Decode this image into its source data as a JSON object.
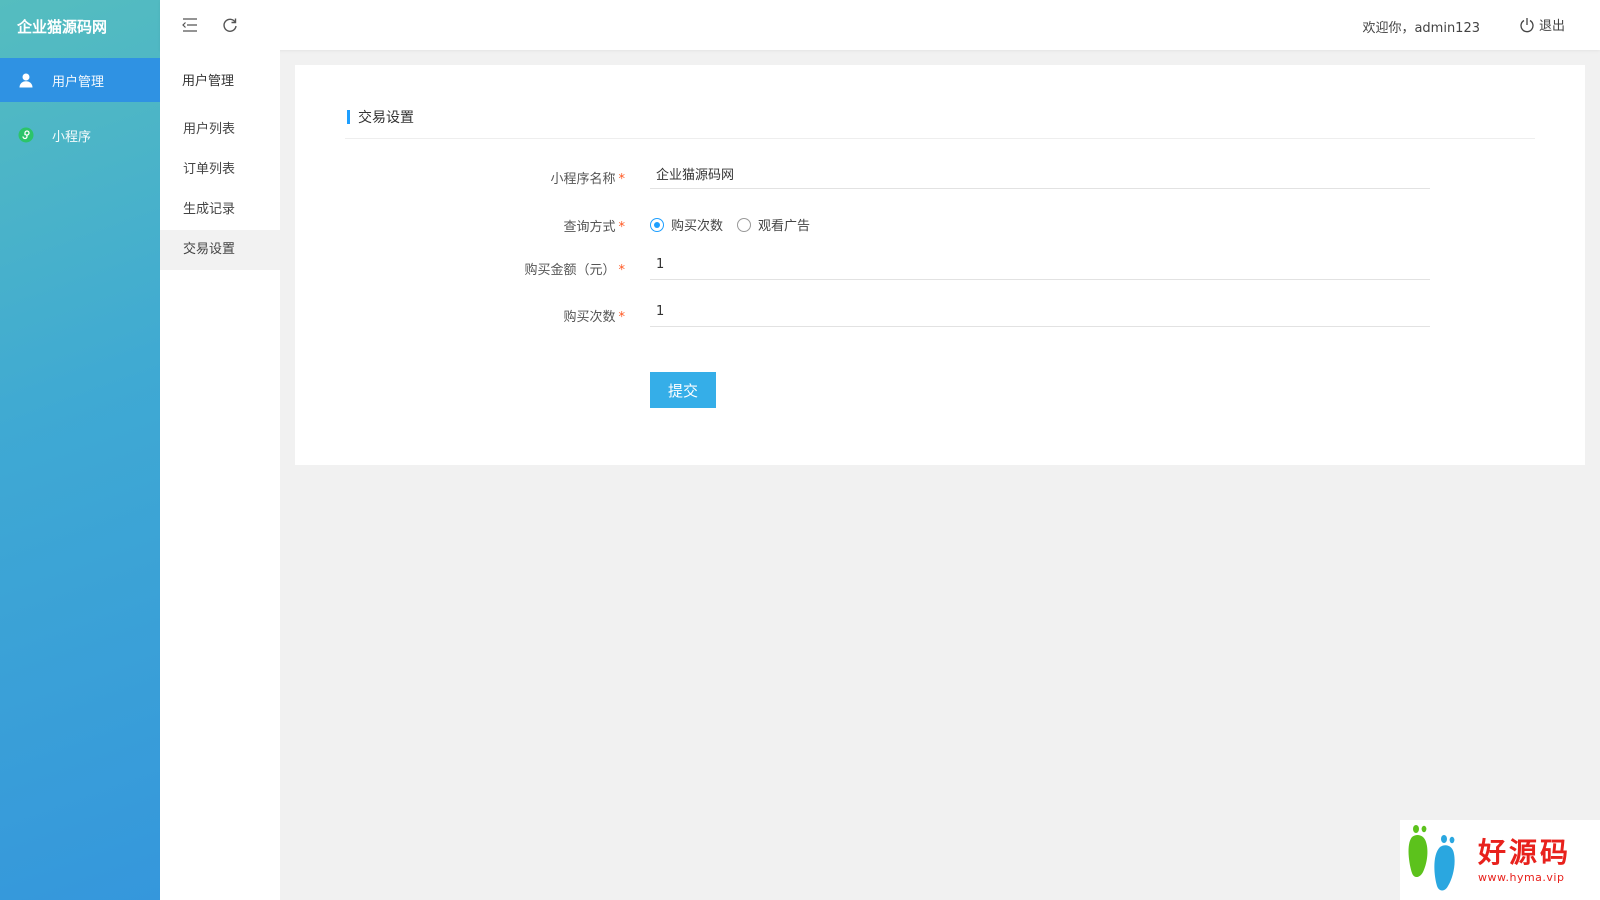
{
  "sidebar": {
    "logo": "企业猫源码网",
    "items": [
      {
        "label": "用户管理",
        "icon": "user-icon"
      },
      {
        "label": "小程序",
        "icon": "miniprogram-icon"
      }
    ]
  },
  "subnav": {
    "title": "用户管理",
    "items": [
      {
        "label": "用户列表"
      },
      {
        "label": "订单列表"
      },
      {
        "label": "生成记录"
      },
      {
        "label": "交易设置"
      }
    ]
  },
  "topbar": {
    "welcome": "欢迎你，admin123",
    "logout_label": "退出"
  },
  "form": {
    "title": "交易设置",
    "name_label": "小程序名称",
    "name_value": "企业猫源码网",
    "query_label": "查询方式",
    "query_options": [
      "购买次数",
      "观看广告"
    ],
    "query_selected": "购买次数",
    "amount_label": "购买金额（元）",
    "amount_value": "1",
    "times_label": "购买次数",
    "times_value": "1",
    "required_mark": "*",
    "submit_label": "提交"
  },
  "watermark": {
    "title": "好源码",
    "url": "www.hyma.vip"
  },
  "colors": {
    "accent": "#1e9fff",
    "button": "#35aee8",
    "sidebar_active": "#2f92e3"
  }
}
